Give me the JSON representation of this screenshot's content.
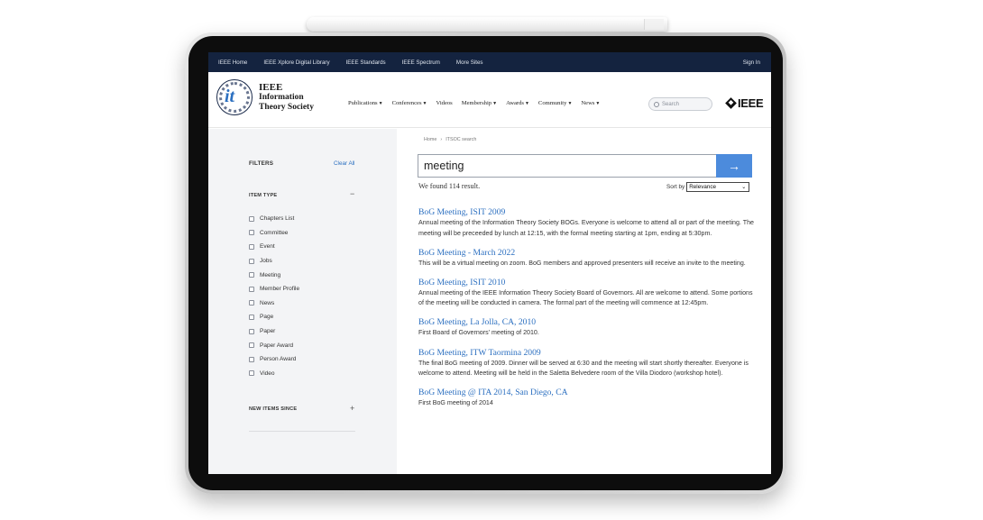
{
  "topbar": {
    "links": [
      "IEEE Home",
      "IEEE Xplore Digital Library",
      "IEEE Standards",
      "IEEE Spectrum",
      "More Sites"
    ],
    "signin": "Sign In"
  },
  "header": {
    "logo_mark": "it",
    "brand_lines": [
      "IEEE",
      "Information",
      "Theory Society"
    ],
    "nav": [
      "Publications",
      "Conferences",
      "Videos",
      "Membership",
      "Awards",
      "Community",
      "News"
    ],
    "search_placeholder": "Search",
    "ieee_logo_text": "IEEE"
  },
  "breadcrumb": [
    "Home",
    "ITSOC search"
  ],
  "sidebar": {
    "filters_title": "FILTERS",
    "clear_all": "Clear All",
    "item_type_title": "ITEM TYPE",
    "item_type_toggle": "−",
    "item_types": [
      "Chapters List",
      "Committee",
      "Event",
      "Jobs",
      "Meeting",
      "Member Profile",
      "News",
      "Page",
      "Paper",
      "Paper Award",
      "Person Award",
      "Video"
    ],
    "new_items_title": "NEW ITEMS SINCE",
    "new_items_toggle": "+"
  },
  "search": {
    "query": "meeting",
    "submit_glyph": "→",
    "found_text": "We found 114 result.",
    "sort_label": "Sort by",
    "sort_value": "Relevance"
  },
  "results": [
    {
      "title": "BoG Meeting, ISIT 2009",
      "desc": "Annual meeting of the Information Theory Society BOGs. Everyone is welcome to attend all or part of the meeting. The meeting will be preceeded by lunch at 12:15, with the formal meeting starting at 1pm, ending at 5:30pm."
    },
    {
      "title": "BoG Meeting - March 2022",
      "desc": "This will be a virtual meeting on zoom. BoG members and approved presenters will receive an invite to the meeting."
    },
    {
      "title": "BoG Meeting, ISIT 2010",
      "desc": "Annual meeting of the IEEE Information Theory Society Board of Governors. All are welcome to attend. Some portions of the meeting will be conducted in camera. The formal part of the meeting will commence at 12:45pm."
    },
    {
      "title": "BoG Meeting, La Jolla, CA, 2010",
      "desc": "First Board of Governors' meeting of 2010."
    },
    {
      "title": "BoG Meeting, ITW Taormina 2009",
      "desc": "The final BoG meeting of 2009. Dinner will be served at 6:30 and the meeting will start shortly thereafter. Everyone is welcome to attend. Meeting will be held in the Saletta Belvedere room of the Villa Diodoro (workshop hotel)."
    },
    {
      "title": "BoG Meeting @ ITA 2014, San Diego, CA",
      "desc": "First BoG meeting of 2014"
    }
  ],
  "colors": {
    "topbar": "#14233f",
    "link": "#2b6fc0",
    "accent_button": "#4c8bdc",
    "sidebar_bg": "#f3f4f6"
  }
}
